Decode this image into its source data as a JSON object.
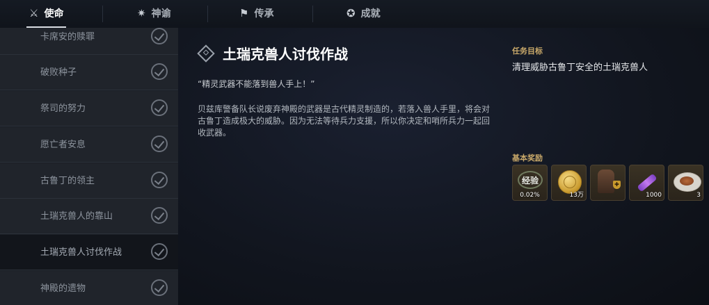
{
  "tabs": [
    {
      "label": "使命",
      "icon": "sword-icon",
      "active": true
    },
    {
      "label": "神谕",
      "icon": "star-icon",
      "active": false
    },
    {
      "label": "传承",
      "icon": "flag-icon",
      "active": false
    },
    {
      "label": "成就",
      "icon": "medal-icon",
      "active": false
    }
  ],
  "missions": [
    {
      "label": "卡席安的赎罪",
      "completed": true
    },
    {
      "label": "破败种子",
      "completed": true
    },
    {
      "label": "祭司的努力",
      "completed": true
    },
    {
      "label": "愿亡者安息",
      "completed": true
    },
    {
      "label": "古鲁丁的领主",
      "completed": true
    },
    {
      "label": "土瑞克兽人的靠山",
      "completed": true
    },
    {
      "label": "土瑞克兽人讨伐作战",
      "completed": true,
      "selected": true
    },
    {
      "label": "神殿的遗物",
      "completed": true
    }
  ],
  "detail": {
    "title": "土瑞克兽人讨伐作战",
    "quote": "“精灵武器不能落到兽人手上！”",
    "description": "贝兹库警备队长说废弃神殿的武器是古代精灵制造的，若落入兽人手里，将会对古鲁丁造成极大的威胁。因为无法等待兵力支援，所以你决定和哨所兵力一起回收武器。"
  },
  "objective": {
    "label": "任务目标",
    "text": "清理威胁古鲁丁安全的土瑞克兽人"
  },
  "rewards": {
    "label": "基本奖励",
    "items": [
      {
        "name": "经验",
        "icon": "exp-icon",
        "qty": "0.02%"
      },
      {
        "icon": "gold-coin-icon",
        "qty": "13万"
      },
      {
        "icon": "cloak-icon",
        "qty": ""
      },
      {
        "icon": "scroll-icon",
        "qty": "1000"
      },
      {
        "icon": "food-plate-icon",
        "qty": "3"
      }
    ]
  },
  "colors": {
    "accent": "#c9a96a",
    "background": "#0d1017",
    "sidebar": "#20242b"
  }
}
